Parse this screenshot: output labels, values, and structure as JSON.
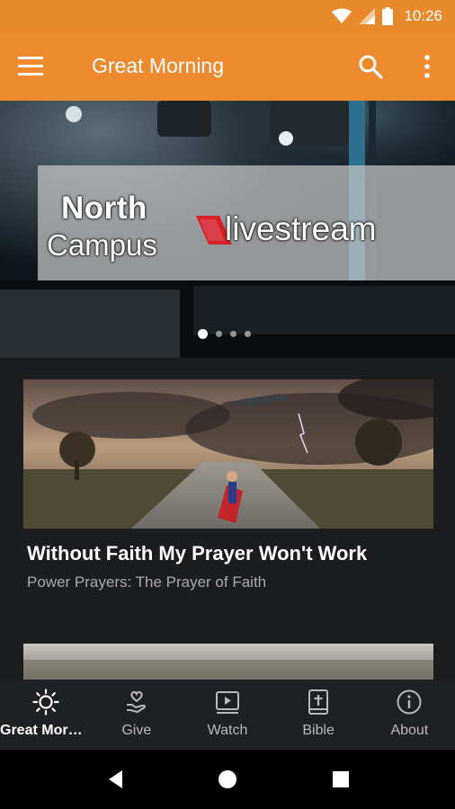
{
  "status_bar": {
    "time": "10:26"
  },
  "app_bar": {
    "title": "Great Morning"
  },
  "hero": {
    "banner_line1": "North",
    "banner_line2": "Campus",
    "brand": "livestream",
    "slide_count": 4,
    "active_slide": 1
  },
  "cards": [
    {
      "title": "Without Faith My Prayer Won't Work",
      "subtitle": "Power Prayers: The Prayer of Faith"
    }
  ],
  "bottom_nav": {
    "items": [
      {
        "label": "Great Morni…",
        "icon": "sun-icon",
        "active": true
      },
      {
        "label": "Give",
        "icon": "give-hand-heart-icon",
        "active": false
      },
      {
        "label": "Watch",
        "icon": "video-play-icon",
        "active": false
      },
      {
        "label": "Bible",
        "icon": "bible-cross-icon",
        "active": false
      },
      {
        "label": "About",
        "icon": "info-icon",
        "active": false
      }
    ]
  },
  "colors": {
    "accent": "#ee8a2e",
    "status_bar": "#e8892c",
    "background": "#1c1d1f",
    "nav_bar": "#1f2022",
    "livestream_red": "#d62027"
  }
}
